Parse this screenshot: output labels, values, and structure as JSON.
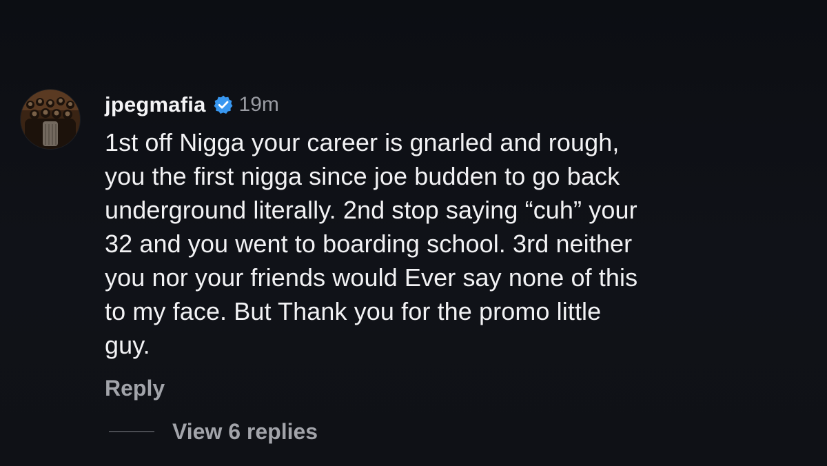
{
  "comment": {
    "username": "jpegmafia",
    "verified": true,
    "timestamp": "19m",
    "text": "1st off Nigga your career is gnarled and rough,\nyou the first nigga since joe budden to go back\nunderground literally. 2nd stop saying “cuh” your\n32 and you went to boarding school. 3rd neither\nyou nor your friends would Ever say none of this\nto my face. But Thank you for the promo little\nguy.",
    "reply_label": "Reply",
    "view_replies_label": "View 6 replies"
  },
  "avatar": {
    "icon": "profile-photo-group"
  },
  "colors": {
    "background": "#0e1015",
    "text_primary": "#f2f2f4",
    "text_secondary": "#9a9ca3",
    "verified_badge": "#3897f0"
  }
}
